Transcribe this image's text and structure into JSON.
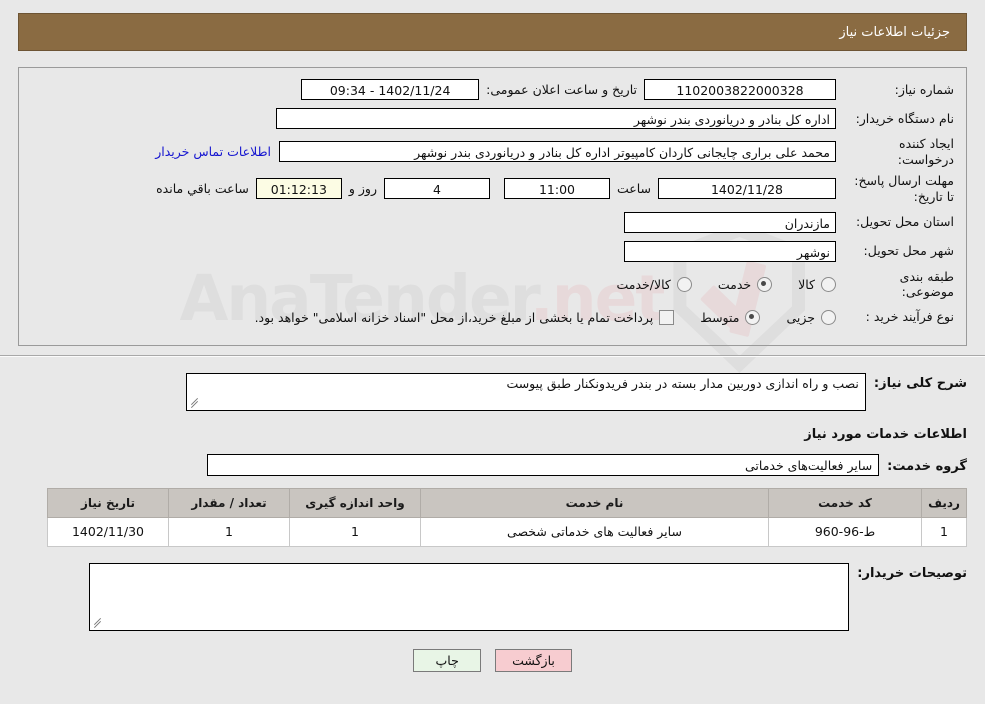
{
  "header": {
    "title": "جزئیات اطلاعات نیاز",
    "bar_color": "#8a6b42"
  },
  "form": {
    "need_number_label": "شماره نیاز:",
    "need_number_value": "1102003822000328",
    "announce_label": "تاریخ و ساعت اعلان عمومی:",
    "announce_value": "1402/11/24 - 09:34",
    "org_label": "نام دستگاه خریدار:",
    "org_value": "اداره کل بنادر و دریانوردی بندر نوشهر",
    "creator_label": "ایجاد کننده درخواست:",
    "creator_value": "محمد علی براری چایجانی کاردان کامپیوتر اداره کل بنادر و دریانوردی بندر نوشهر",
    "contact_link": "اطلاعات تماس خریدار",
    "deadline_label": "مهلت ارسال پاسخ: تا تاریخ:",
    "deadline_date": "1402/11/28",
    "time_label": "ساعت",
    "time_value": "11:00",
    "days_value": "4",
    "days_label": "روز و",
    "countdown_value": "01:12:13",
    "countdown_label": "ساعت باقي مانده",
    "province_label": "استان محل تحویل:",
    "province_value": "مازندران",
    "city_label": "شهر محل تحویل:",
    "city_value": "نوشهر",
    "category_label": "طبقه بندی موضوعی:",
    "category_options": [
      {
        "label": "کالا",
        "selected": false
      },
      {
        "label": "خدمت",
        "selected": true
      },
      {
        "label": "کالا/خدمت",
        "selected": false
      }
    ],
    "process_label": "نوع فرآیند خرید :",
    "process_options": [
      {
        "label": "جزیی",
        "selected": false
      },
      {
        "label": "متوسط",
        "selected": true
      }
    ],
    "treasury_checked": false,
    "treasury_note": "پرداخت تمام یا بخشی از مبلغ خرید،از محل \"اسناد خزانه اسلامی\" خواهد بود."
  },
  "description": {
    "label": "شرح کلی نیاز:",
    "value": "نصب و راه اندازی دوربین مدار بسته در بندر فریدونکنار طبق پیوست"
  },
  "services": {
    "heading": "اطلاعات خدمات مورد نیاز",
    "group_label": "گروه خدمت:",
    "group_value": "سایر فعالیت‌های خدماتی",
    "table": {
      "columns": [
        "ردیف",
        "کد خدمت",
        "نام خدمت",
        "واحد اندازه گیری",
        "تعداد / مقدار",
        "تاریخ نیاز"
      ],
      "rows": [
        {
          "index": "1",
          "code": "ط-96-960",
          "name": "سایر فعالیت های خدماتی شخصی",
          "unit": "1",
          "quantity": "1",
          "need_date": "1402/11/30"
        }
      ]
    }
  },
  "comments": {
    "label": "توصیحات خریدار:",
    "value": ""
  },
  "footer": {
    "print_label": "چاپ",
    "back_label": "بازگشت"
  },
  "watermark": {
    "text": "AnaTender",
    "tld": ".net"
  }
}
